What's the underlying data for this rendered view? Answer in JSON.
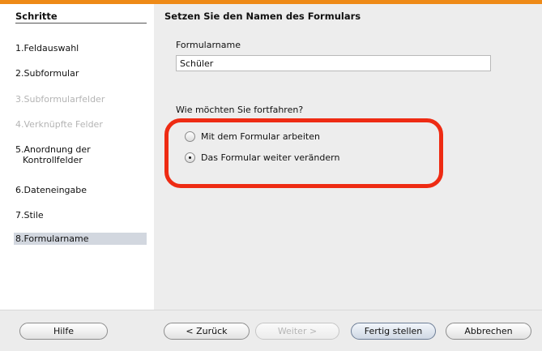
{
  "sidebar": {
    "title": "Schritte",
    "steps": [
      {
        "num": "1.",
        "label": "Feldauswahl",
        "state": "normal"
      },
      {
        "num": "2.",
        "label": "Subformular",
        "state": "normal"
      },
      {
        "num": "3.",
        "label": "Subformularfelder",
        "state": "disabled"
      },
      {
        "num": "4.",
        "label": "Verknüpfte Felder",
        "state": "disabled"
      },
      {
        "num": "5.",
        "label": "Anordnung der",
        "label2": "Kontrollfelder",
        "state": "normal"
      },
      {
        "num": "6.",
        "label": "Dateneingabe",
        "state": "normal"
      },
      {
        "num": "7.",
        "label": "Stile",
        "state": "normal"
      },
      {
        "num": "8.",
        "label": "Formularname",
        "state": "active"
      }
    ]
  },
  "main": {
    "title": "Setzen Sie den Namen des Formulars",
    "name_label": "Formularname",
    "name_value": "Schüler",
    "question": "Wie möchten Sie fortfahren?",
    "options": [
      {
        "label": "Mit dem Formular arbeiten",
        "checked": false
      },
      {
        "label": "Das Formular weiter verändern",
        "checked": true
      }
    ]
  },
  "footer": {
    "help": "Hilfe",
    "back": "< Zurück",
    "next": "Weiter >",
    "finish": "Fertig stellen",
    "cancel": "Abbrechen"
  },
  "colors": {
    "accent_bar": "#ee8a17",
    "highlight": "#ee2b13",
    "active_step": "#d2d7df"
  }
}
